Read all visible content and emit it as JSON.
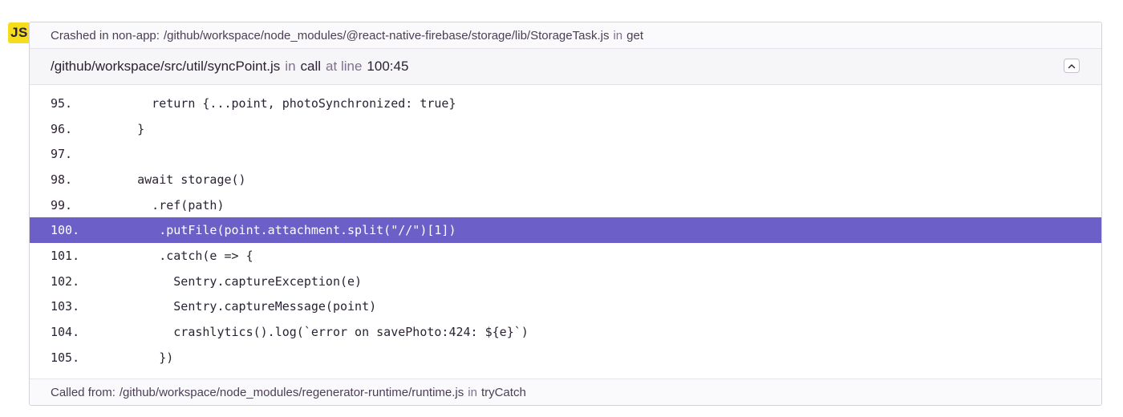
{
  "platform": {
    "badge": "JS"
  },
  "crashed": {
    "prefix": "Crashed in non-app:",
    "path": "/github/workspace/node_modules/@react-native-firebase/storage/lib/StorageTask.js",
    "in_label": "in",
    "function": "get"
  },
  "frame": {
    "file": "/github/workspace/src/util/syncPoint.js",
    "in_label": "in",
    "function": "call",
    "at_line_label": "at line",
    "location": "100:45",
    "collapse_icon": "chevron-up-icon"
  },
  "code": {
    "highlight_line": "100.",
    "lines": [
      {
        "no": "95.",
        "text": "      return {...point, photoSynchronized: true}"
      },
      {
        "no": "96.",
        "text": "    }"
      },
      {
        "no": "97.",
        "text": ""
      },
      {
        "no": "98.",
        "text": "    await storage()"
      },
      {
        "no": "99.",
        "text": "      .ref(path)"
      },
      {
        "no": "100.",
        "text": "       .putFile(point.attachment.split(\"//\")[1])"
      },
      {
        "no": "101.",
        "text": "       .catch(e => {"
      },
      {
        "no": "102.",
        "text": "         Sentry.captureException(e)"
      },
      {
        "no": "103.",
        "text": "         Sentry.captureMessage(point)"
      },
      {
        "no": "104.",
        "text": "         crashlytics().log(`error on savePhoto:424: ${e}`)"
      },
      {
        "no": "105.",
        "text": "       })"
      }
    ]
  },
  "called_from": {
    "prefix": "Called from:",
    "path": "/github/workspace/node_modules/regenerator-runtime/runtime.js",
    "in_label": "in",
    "function": "tryCatch"
  },
  "colors": {
    "highlight": "#6c5fc7",
    "badge": "#f5dd1e"
  }
}
